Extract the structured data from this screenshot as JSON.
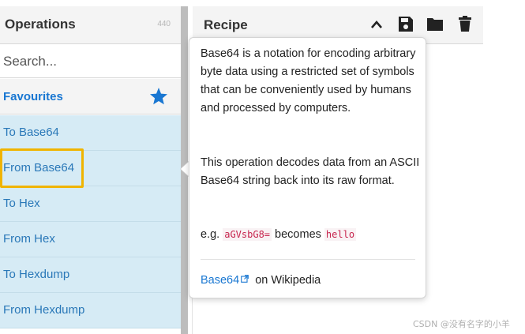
{
  "operations": {
    "title": "Operations",
    "count": "440",
    "search_placeholder": "Search...",
    "favourites_label": "Favourites",
    "items": [
      {
        "label": "To Base64"
      },
      {
        "label": "From Base64"
      },
      {
        "label": "To Hex"
      },
      {
        "label": "From Hex"
      },
      {
        "label": "To Hexdump"
      },
      {
        "label": "From Hexdump"
      }
    ]
  },
  "recipe": {
    "title": "Recipe",
    "icons": [
      "chevron-up-icon",
      "save-icon",
      "folder-icon",
      "trash-icon"
    ]
  },
  "tooltip": {
    "p1": "Base64 is a notation for encoding arbitrary byte data using a restricted set of symbols that can be conveniently used by humans and processed by computers.",
    "p2": "This operation decodes data from an ASCII Base64 string back into its raw format.",
    "example_prefix": "e.g. ",
    "example_input": "aGVsbG8=",
    "example_middle": " becomes ",
    "example_output": "hello",
    "link_text": "Base64",
    "link_suffix": " on Wikipedia"
  },
  "watermark": "CSDN @没有名字的小羊",
  "colors": {
    "accent": "#1977d2",
    "favourite_bg": "#d6ebf5",
    "highlight": "#f0b400",
    "code": "#c7254e"
  }
}
